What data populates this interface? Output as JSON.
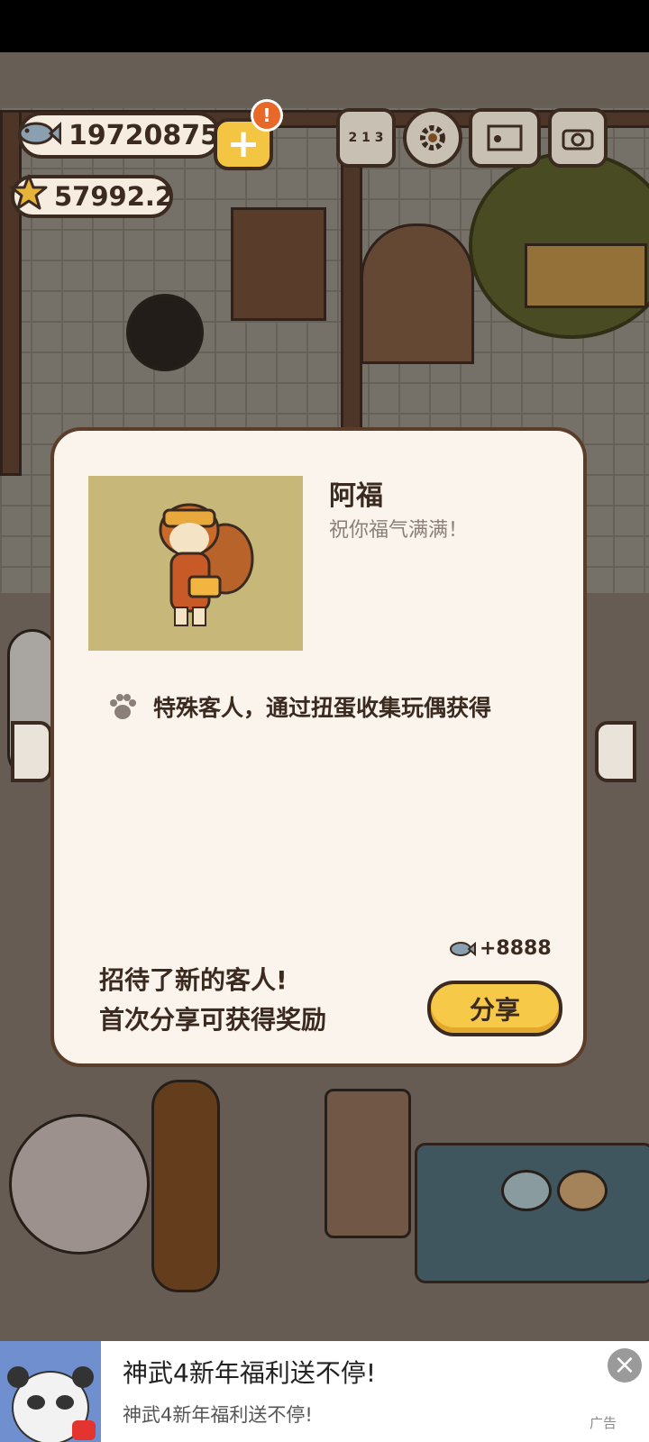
{
  "hud": {
    "fish_count": "19720875",
    "star_count": "57992.2",
    "add_label": "+",
    "alert_label": "!",
    "icons": [
      "ranking-icon",
      "settings-icon",
      "guestbook-icon",
      "camera-icon"
    ],
    "ranking_text": "2 1 3"
  },
  "guest_card": {
    "name": "阿福",
    "greeting": "祝你福气满满！",
    "description": "特殊客人，通过扭蛋收集玩偶获得",
    "reward": "+8888",
    "share_message_line1": "招待了新的客人!",
    "share_message_line2": "首次分享可获得奖励",
    "share_button": "分享"
  },
  "ad": {
    "title": "神武4新年福利送不停!",
    "subtitle": "神武4新年福利送不停!",
    "close_label": "×",
    "tag": "广告"
  },
  "colors": {
    "panel_bg": "#fbf4ec",
    "outline": "#3b2a20",
    "button_yellow": "#f7c948",
    "portrait_bg": "#c7b779"
  }
}
